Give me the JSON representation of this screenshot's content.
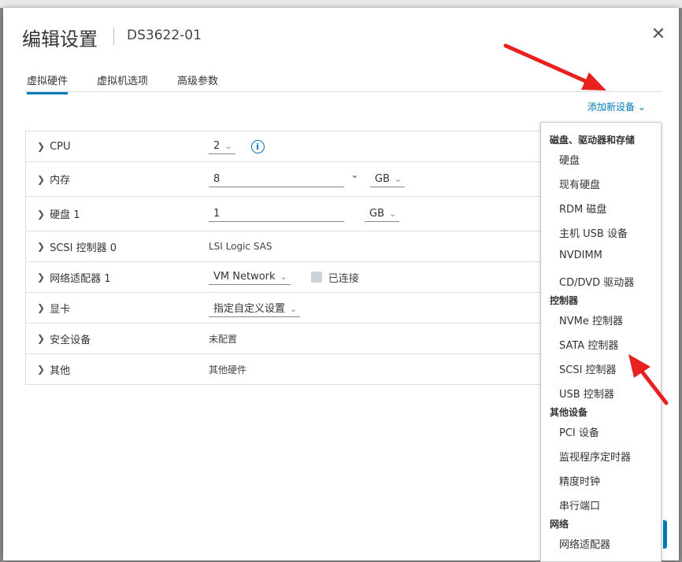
{
  "dialog": {
    "title": "编辑设置",
    "subtitle": "DS3622-01",
    "close_glyph": "✕"
  },
  "tabs": [
    {
      "label": "虚拟硬件",
      "active": true
    },
    {
      "label": "虚拟机选项",
      "active": false
    },
    {
      "label": "高级参数",
      "active": false
    }
  ],
  "add_device": {
    "label": "添加新设备",
    "caret": "⌄"
  },
  "hardware": {
    "cpu": {
      "label": "CPU",
      "value": "2"
    },
    "memory": {
      "label": "内存",
      "value": "8",
      "unit": "GB"
    },
    "disk": {
      "label": "硬盘 1",
      "value": "1",
      "unit": "GB"
    },
    "scsi": {
      "label": "SCSI 控制器 0",
      "value": "LSI Logic SAS"
    },
    "network": {
      "label": "网络适配器 1",
      "value": "VM Network",
      "connected_label": "已连接"
    },
    "video": {
      "label": "显卡",
      "value": "指定自定义设置"
    },
    "security": {
      "label": "安全设备",
      "value": "未配置"
    },
    "other": {
      "label": "其他",
      "value": "其他硬件"
    }
  },
  "device_menu": {
    "group_storage": "磁盘、驱动器和存储",
    "hard_disk": "硬盘",
    "existing_disk": "现有硬盘",
    "rdm_disk": "RDM 磁盘",
    "host_usb": "主机 USB 设备",
    "nvdimm": "NVDIMM",
    "cd_dvd": "CD/DVD 驱动器",
    "group_controllers": "控制器",
    "nvme": "NVMe 控制器",
    "sata": "SATA 控制器",
    "scsi": "SCSI 控制器",
    "usb": "USB 控制器",
    "group_other": "其他设备",
    "pci": "PCI 设备",
    "watchdog": "监视程序定时器",
    "precision_clock": "精度时钟",
    "serial_port": "串行端口",
    "group_network": "网络",
    "network_adapter": "网络适配器"
  },
  "colors": {
    "accent": "#0079b8",
    "arrow": "#e8201f"
  }
}
